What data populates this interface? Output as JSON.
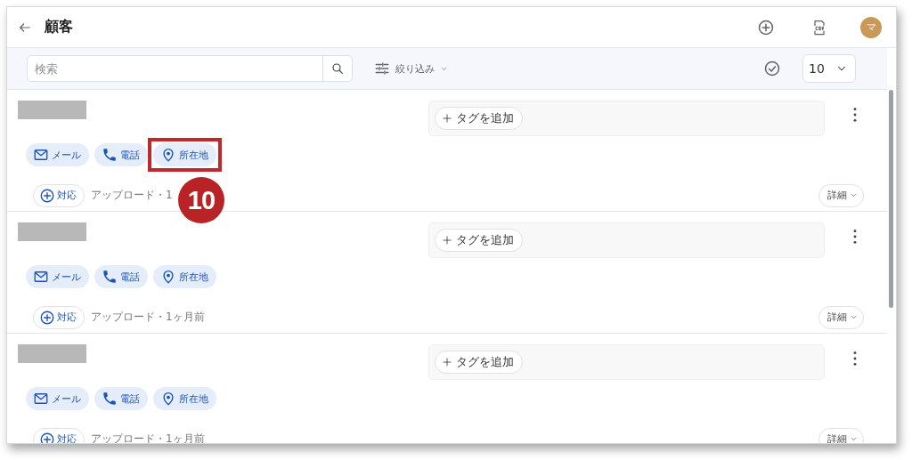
{
  "header": {
    "title": "顧客",
    "avatar": "マ"
  },
  "toolbar": {
    "search": {
      "placeholder": "検索"
    },
    "filter": "絞り込み",
    "page_size": "10"
  },
  "customers": [
    {
      "tag_button": "タグを追加",
      "contacts": [
        {
          "kind": "email",
          "label": "メール",
          "highlighted": false
        },
        {
          "kind": "phone",
          "label": "電話",
          "highlighted": false
        },
        {
          "kind": "location",
          "label": "所在地",
          "highlighted": true
        }
      ],
      "action": "対応",
      "meta": "アップロード・1",
      "details": "詳細",
      "callout": "10"
    },
    {
      "tag_button": "タグを追加",
      "contacts": [
        {
          "kind": "email",
          "label": "メール",
          "highlighted": false
        },
        {
          "kind": "phone",
          "label": "電話",
          "highlighted": false
        },
        {
          "kind": "location",
          "label": "所在地",
          "highlighted": false
        }
      ],
      "action": "対応",
      "meta": "アップロード・1ヶ月前",
      "details": "詳細"
    },
    {
      "tag_button": "タグを追加",
      "contacts": [
        {
          "kind": "email",
          "label": "メール",
          "highlighted": false
        },
        {
          "kind": "phone",
          "label": "電話",
          "highlighted": false
        },
        {
          "kind": "location",
          "label": "所在地",
          "highlighted": false
        }
      ],
      "action": "対応",
      "meta": "アップロード・1ヶ月前",
      "details": "詳細"
    }
  ]
}
